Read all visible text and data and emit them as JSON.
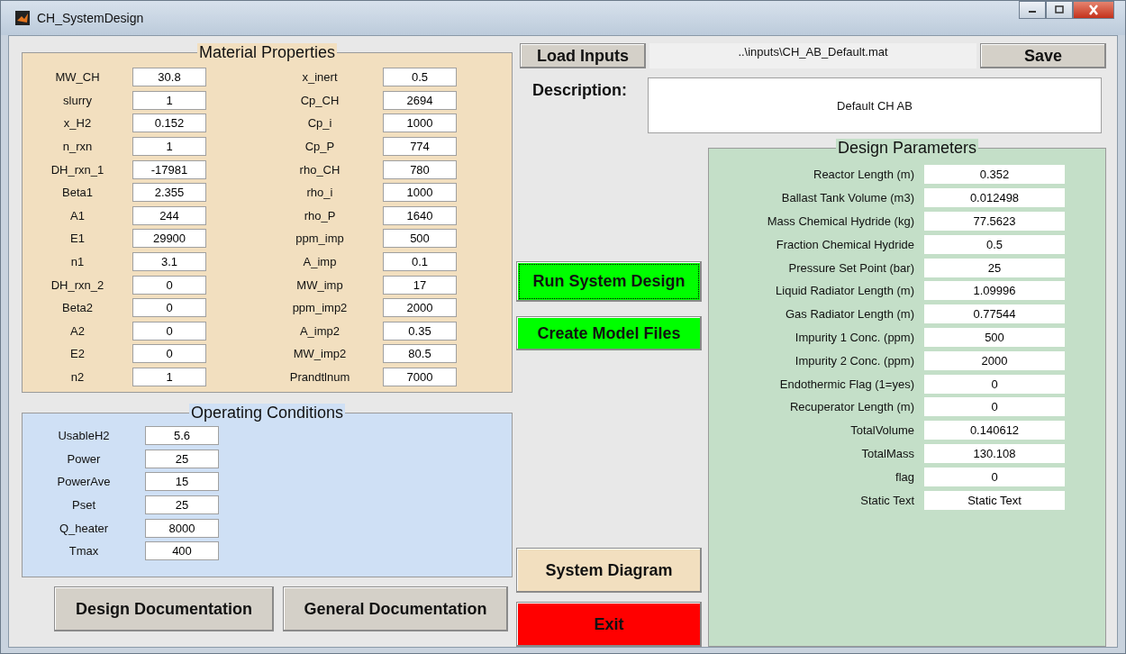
{
  "window": {
    "title": "CH_SystemDesign"
  },
  "material_properties": {
    "title": "Material Properties",
    "left": [
      {
        "label": "MW_CH",
        "value": "30.8"
      },
      {
        "label": "slurry",
        "value": "1"
      },
      {
        "label": "x_H2",
        "value": "0.152"
      },
      {
        "label": "n_rxn",
        "value": "1"
      },
      {
        "label": "DH_rxn_1",
        "value": "-17981"
      },
      {
        "label": "Beta1",
        "value": "2.355"
      },
      {
        "label": "A1",
        "value": "244"
      },
      {
        "label": "E1",
        "value": "29900"
      },
      {
        "label": "n1",
        "value": "3.1"
      },
      {
        "label": "DH_rxn_2",
        "value": "0"
      },
      {
        "label": "Beta2",
        "value": "0"
      },
      {
        "label": "A2",
        "value": "0"
      },
      {
        "label": "E2",
        "value": "0"
      },
      {
        "label": "n2",
        "value": "1"
      }
    ],
    "right": [
      {
        "label": "x_inert",
        "value": "0.5"
      },
      {
        "label": "Cp_CH",
        "value": "2694"
      },
      {
        "label": "Cp_i",
        "value": "1000"
      },
      {
        "label": "Cp_P",
        "value": "774"
      },
      {
        "label": "rho_CH",
        "value": "780"
      },
      {
        "label": "rho_i",
        "value": "1000"
      },
      {
        "label": "rho_P",
        "value": "1640"
      },
      {
        "label": "ppm_imp",
        "value": "500"
      },
      {
        "label": "A_imp",
        "value": "0.1"
      },
      {
        "label": "MW_imp",
        "value": "17"
      },
      {
        "label": "ppm_imp2",
        "value": "2000"
      },
      {
        "label": "A_imp2",
        "value": "0.35"
      },
      {
        "label": "MW_imp2",
        "value": "80.5"
      },
      {
        "label": "Prandtlnum",
        "value": "7000"
      }
    ]
  },
  "operating_conditions": {
    "title": "Operating Conditions",
    "fields": [
      {
        "label": "UsableH2",
        "value": "5.6"
      },
      {
        "label": "Power",
        "value": "25"
      },
      {
        "label": "PowerAve",
        "value": "15"
      },
      {
        "label": "Pset",
        "value": "25"
      },
      {
        "label": "Q_heater",
        "value": "8000"
      },
      {
        "label": "Tmax",
        "value": "400"
      }
    ]
  },
  "doc_buttons": [
    "Design Documentation",
    "General Documentation"
  ],
  "load_button": "Load Inputs",
  "file_path": "..\\inputs\\CH_AB_Default.mat",
  "save_button": "Save",
  "description": {
    "label": "Description:",
    "value": "Default CH AB"
  },
  "action_buttons": [
    {
      "label": "Run System Design",
      "color": "#00ff00",
      "focused": true
    },
    {
      "label": "Create Model Files",
      "color": "#00ff00",
      "focused": false
    }
  ],
  "bottom_buttons": [
    {
      "label": "System Diagram",
      "color": "#f2dfbf"
    },
    {
      "label": "Exit",
      "color": "#ff0000"
    }
  ],
  "design_parameters": {
    "title": "Design Parameters",
    "fields": [
      {
        "label": "Reactor Length (m)",
        "value": "0.352"
      },
      {
        "label": "Ballast Tank Volume (m3)",
        "value": "0.012498"
      },
      {
        "label": "Mass Chemical Hydride (kg)",
        "value": "77.5623"
      },
      {
        "label": "Fraction Chemical Hydride",
        "value": "0.5"
      },
      {
        "label": "Pressure Set Point (bar)",
        "value": "25"
      },
      {
        "label": "Liquid Radiator Length (m)",
        "value": "1.09996"
      },
      {
        "label": "Gas Radiator Length (m)",
        "value": "0.77544"
      },
      {
        "label": "Impurity 1 Conc. (ppm)",
        "value": "500"
      },
      {
        "label": "Impurity 2 Conc. (ppm)",
        "value": "2000"
      },
      {
        "label": "Endothermic Flag (1=yes)",
        "value": "0"
      },
      {
        "label": "Recuperator Length (m)",
        "value": "0"
      },
      {
        "label": "TotalVolume",
        "value": "0.140612"
      },
      {
        "label": "TotalMass",
        "value": "130.108"
      },
      {
        "label": "flag",
        "value": "0"
      },
      {
        "label": "Static Text",
        "value": "Static Text"
      }
    ]
  }
}
